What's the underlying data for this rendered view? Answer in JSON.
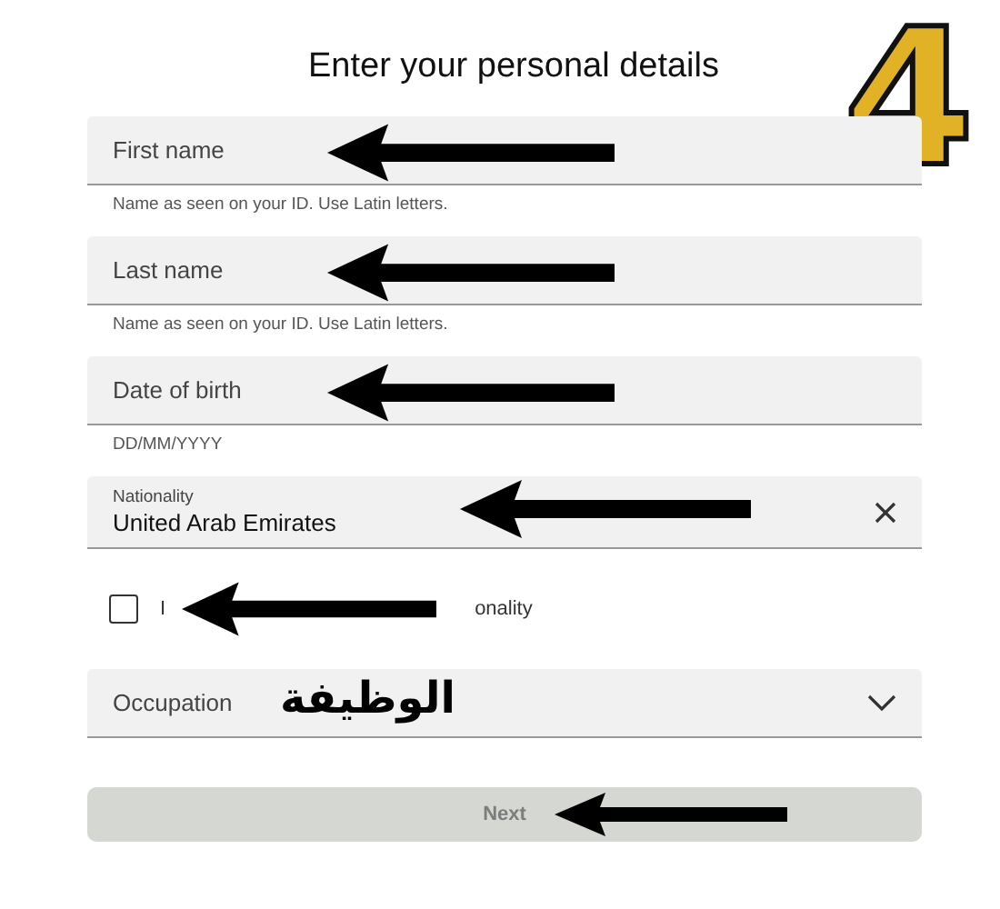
{
  "title": "Enter your personal details",
  "step_badge": "4",
  "fields": [
    {
      "kind": "text",
      "placeholder": "First name",
      "hint": "Name as seen on your ID. Use Latin letters."
    },
    {
      "kind": "text",
      "placeholder": "Last name",
      "hint": "Name as seen on your ID. Use Latin letters."
    },
    {
      "kind": "text",
      "placeholder": "Date of birth",
      "hint": "DD/MM/YYYY"
    },
    {
      "kind": "select",
      "label": "Nationality",
      "value": "United Arab Emirates"
    }
  ],
  "checkbox": {
    "checked": false,
    "label_parts": [
      "I",
      "onality"
    ]
  },
  "occupation": {
    "placeholder": "Occupation",
    "annotation": "الوظيفة"
  },
  "next_button": {
    "label": "Next",
    "disabled": true
  }
}
